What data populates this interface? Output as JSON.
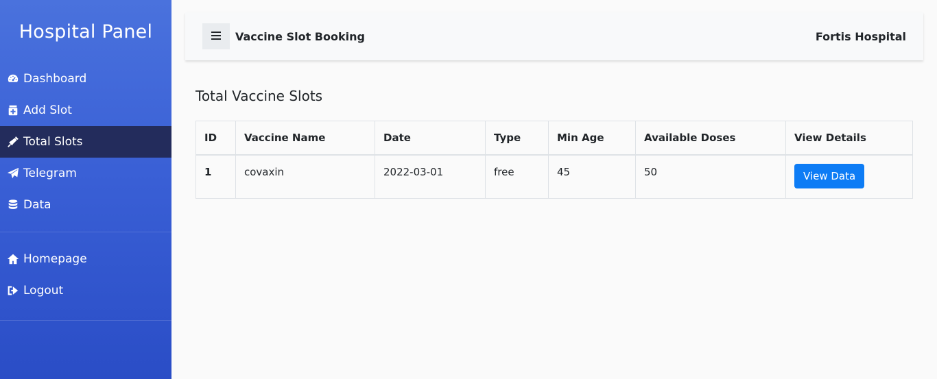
{
  "sidebar": {
    "brand": "Hospital Panel",
    "items": [
      {
        "label": "Dashboard",
        "icon": "tachometer-icon"
      },
      {
        "label": "Add Slot",
        "icon": "medical-plus-icon"
      },
      {
        "label": "Total Slots",
        "icon": "syringe-icon",
        "active": true
      },
      {
        "label": "Telegram",
        "icon": "paper-plane-icon"
      },
      {
        "label": "Data",
        "icon": "database-icon"
      }
    ],
    "bottom_items": [
      {
        "label": "Homepage",
        "icon": "home-icon"
      },
      {
        "label": "Logout",
        "icon": "sign-out-icon"
      }
    ]
  },
  "topbar": {
    "toggle_icon": "hamburger-menu-icon",
    "title": "Vaccine Slot Booking",
    "hospital_name": "Fortis Hospital"
  },
  "main": {
    "heading": "Total Vaccine Slots",
    "table": {
      "headers": [
        "ID",
        "Vaccine Name",
        "Date",
        "Type",
        "Min Age",
        "Available Doses",
        "View Details"
      ],
      "rows": [
        {
          "id": "1",
          "vaccine_name": "covaxin",
          "date": "2022-03-01",
          "type": "free",
          "min_age": "45",
          "available_doses": "50",
          "action_label": "View Data"
        }
      ]
    }
  },
  "colors": {
    "sidebar_gradient_top": "#4a72dd",
    "sidebar_gradient_bottom": "#2a4dc6",
    "active_item_bg": "#232c5c",
    "primary_button": "#0d7cf5"
  }
}
